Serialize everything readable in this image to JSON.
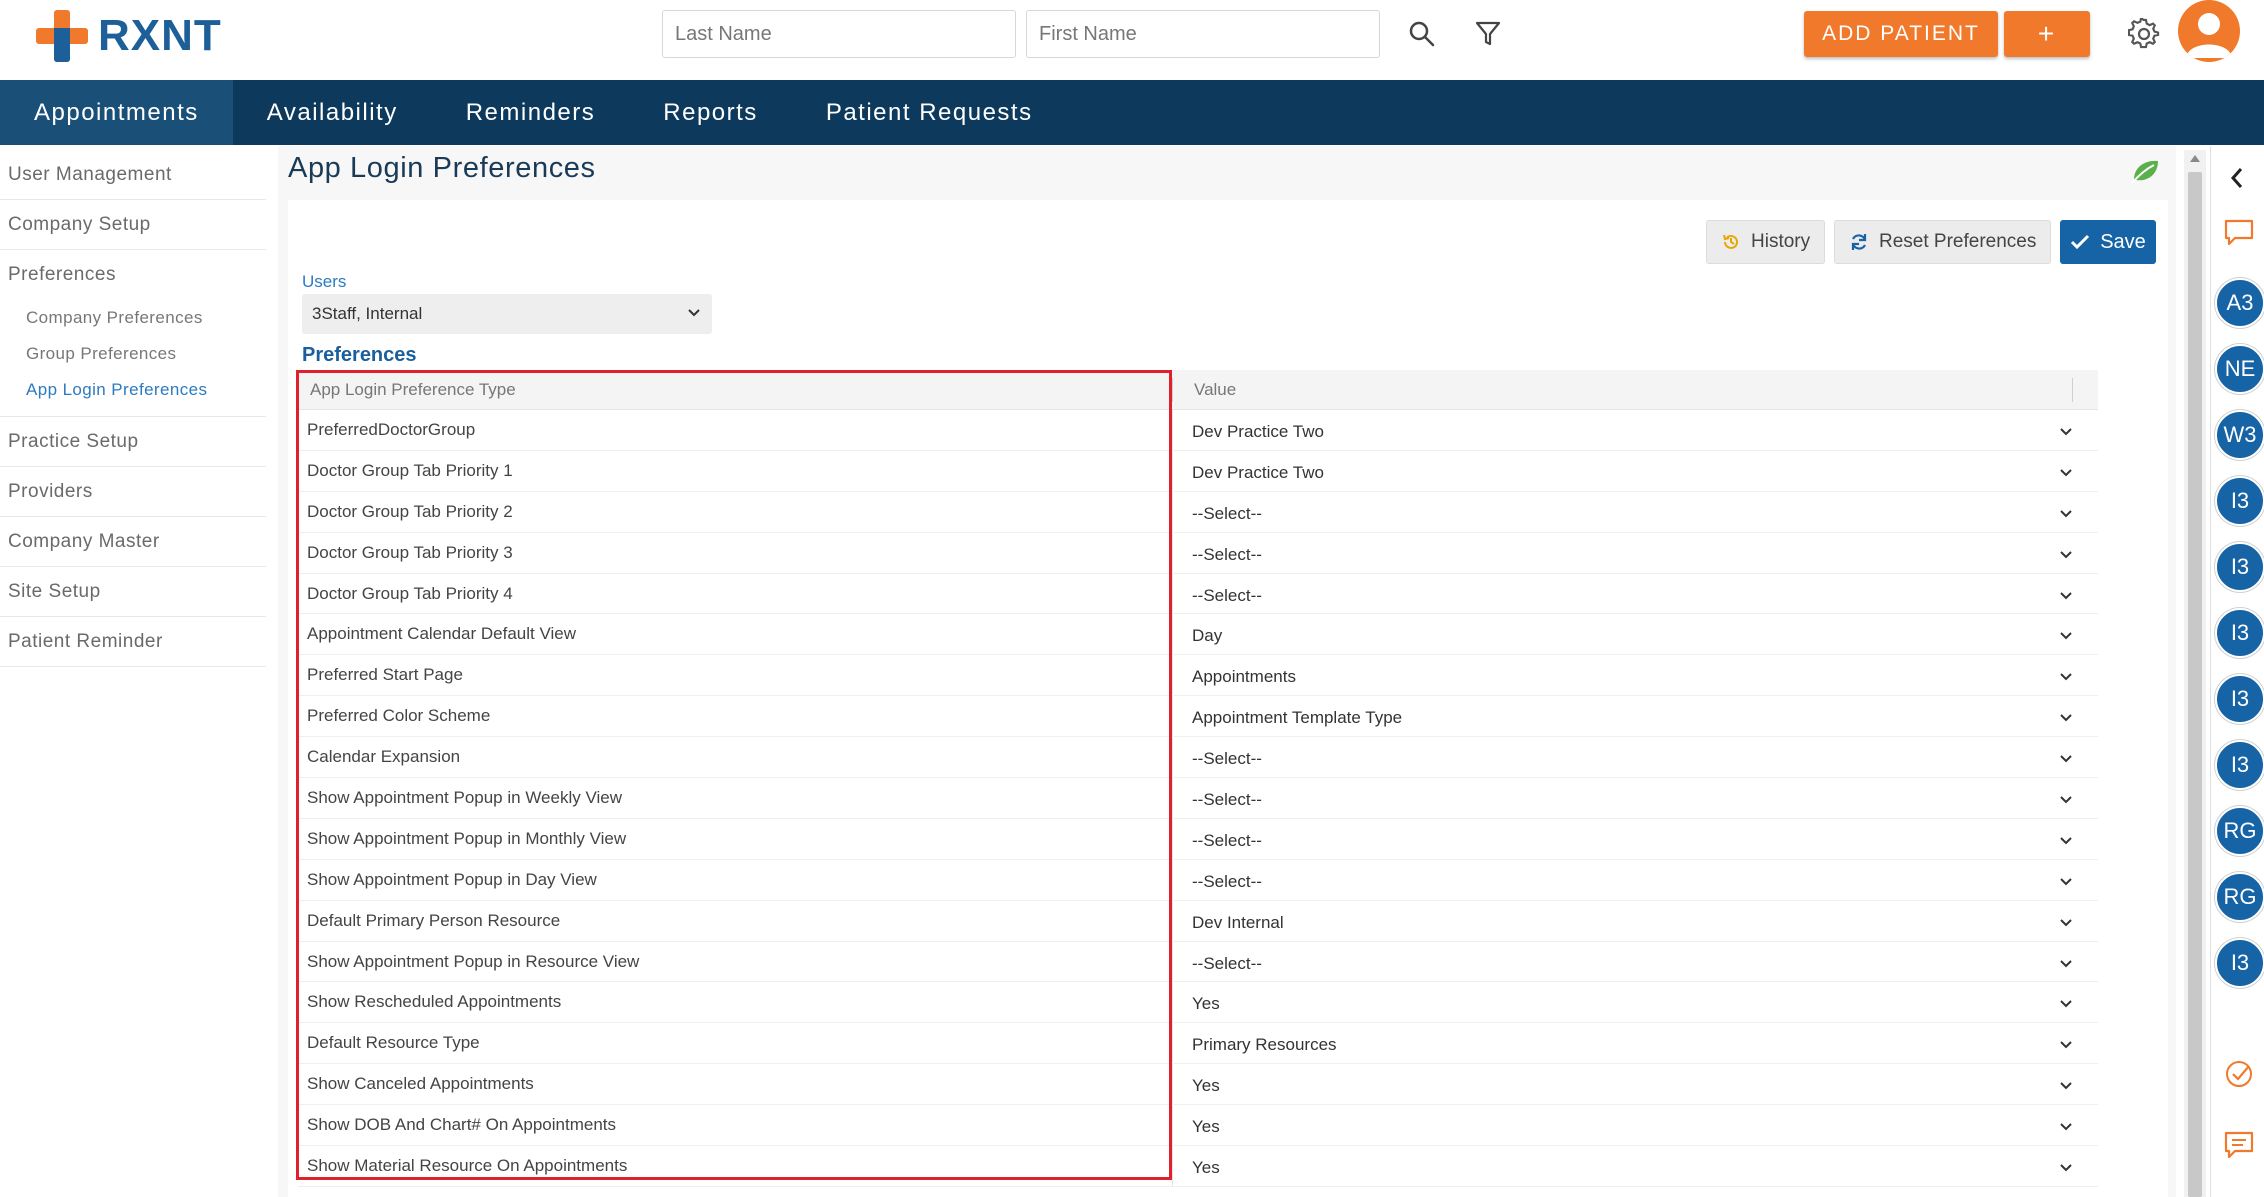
{
  "app": {
    "logo_text": "RXNT",
    "search_last_placeholder": "Last Name",
    "search_first_placeholder": "First Name",
    "add_patient_label": "ADD PATIENT",
    "add_plus_label": "+"
  },
  "nav": {
    "items": [
      "Appointments",
      "Availability",
      "Reminders",
      "Reports",
      "Patient Requests"
    ],
    "active": "Appointments"
  },
  "sidebar": {
    "items": [
      "User Management",
      "Company Setup",
      "Preferences",
      "Practice Setup",
      "Providers",
      "Company Master",
      "Site Setup",
      "Patient Reminder"
    ],
    "sub_items": [
      "Company Preferences",
      "Group Preferences",
      "App Login Preferences"
    ],
    "active_sub": "App Login Preferences"
  },
  "page": {
    "title": "App Login Preferences",
    "history_label": "History",
    "reset_label": "Reset Preferences",
    "save_label": "Save",
    "users_label": "Users",
    "users_selected": "3Staff, Internal",
    "preferences_label": "Preferences"
  },
  "table": {
    "col_type": "App Login Preference Type",
    "col_value": "Value",
    "rows": [
      {
        "type": "PreferredDoctorGroup",
        "value": "Dev Practice Two"
      },
      {
        "type": "Doctor Group Tab Priority 1",
        "value": "Dev Practice Two"
      },
      {
        "type": "Doctor Group Tab Priority 2",
        "value": "--Select--"
      },
      {
        "type": "Doctor Group Tab Priority 3",
        "value": "--Select--"
      },
      {
        "type": "Doctor Group Tab Priority 4",
        "value": "--Select--"
      },
      {
        "type": "Appointment Calendar Default View",
        "value": "Day"
      },
      {
        "type": "Preferred Start Page",
        "value": "Appointments"
      },
      {
        "type": "Preferred Color Scheme",
        "value": "Appointment Template Type"
      },
      {
        "type": "Calendar Expansion",
        "value": "--Select--"
      },
      {
        "type": "Show Appointment Popup in Weekly View",
        "value": "--Select--"
      },
      {
        "type": "Show Appointment Popup in Monthly View",
        "value": "--Select--"
      },
      {
        "type": "Show Appointment Popup in Day View",
        "value": "--Select--"
      },
      {
        "type": "Default Primary Person Resource",
        "value": "Dev Internal"
      },
      {
        "type": "Show Appointment Popup in Resource View",
        "value": "--Select--"
      },
      {
        "type": "Show Rescheduled Appointments",
        "value": "Yes"
      },
      {
        "type": "Default Resource Type",
        "value": "Primary Resources"
      },
      {
        "type": "Show Canceled Appointments",
        "value": "Yes"
      },
      {
        "type": "Show DOB And Chart# On Appointments",
        "value": "Yes"
      },
      {
        "type": "Show Material Resource On Appointments",
        "value": "Yes"
      }
    ]
  },
  "rail": {
    "avatars": [
      "A3",
      "NE",
      "W3",
      "I3",
      "I3",
      "I3",
      "I3",
      "I3",
      "RG",
      "RG",
      "I3"
    ]
  },
  "colors": {
    "brand_blue": "#1d5f99",
    "brand_orange": "#f0792b",
    "nav_bg": "#0d3a5c",
    "highlight_red": "#e0202b",
    "save_blue": "#1663a6"
  }
}
